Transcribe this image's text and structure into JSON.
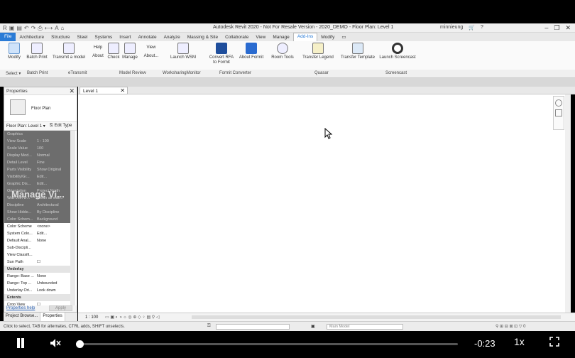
{
  "titlebar": {
    "title": "Autodesk Revit 2020 - Not For Resale Version - 2020_DEMO - Floor Plan: Level 1",
    "user": "minnieung",
    "qat_icons": [
      "revit-logo-icon",
      "open-icon",
      "save-icon",
      "undo-icon",
      "redo-icon",
      "print-icon",
      "measure-icon",
      "text-icon",
      "3d-view-icon"
    ]
  },
  "menu": {
    "file": "File",
    "tabs": [
      "Architecture",
      "Structure",
      "Steel",
      "Systems",
      "Insert",
      "Annotate",
      "Analyze",
      "Massing & Site",
      "Collaborate",
      "View",
      "Manage",
      "Add-Ins",
      "Modify"
    ],
    "active_tab": "Add-Ins"
  },
  "ribbon": {
    "buttons": [
      {
        "label": "Modify",
        "icon": "cursor-icon"
      },
      {
        "label": "Batch Print",
        "icon": "printer-icon"
      },
      {
        "label": "Transmit a model",
        "icon": "transmit-icon"
      },
      {
        "label": "About",
        "icon": "help-icon"
      },
      {
        "label": "Check",
        "icon": "check-icon"
      },
      {
        "label": "Manage",
        "icon": "manage-icon"
      },
      {
        "label": "About...",
        "icon": "view-icon"
      },
      {
        "label": "Launch WSM",
        "icon": "wsm-icon"
      },
      {
        "label": "Convert RFA to Formit",
        "icon": "formit-icon"
      },
      {
        "label": "About Formit",
        "icon": "formit-about-icon"
      },
      {
        "label": "Room Tools",
        "icon": "room-tools-icon"
      },
      {
        "label": "Transfer Legend",
        "icon": "legend-icon"
      },
      {
        "label": "Transfer Template",
        "icon": "template-icon"
      },
      {
        "label": "Launch Screencast",
        "icon": "screencast-icon"
      }
    ],
    "help_label": "Help",
    "view_label": "View",
    "panels": [
      "Select ▾",
      "Batch Print",
      "eTransmit",
      "Model Review",
      "WorksharingMonitor",
      "Formit Converter",
      "Quasar",
      "Screencast"
    ]
  },
  "properties": {
    "title": "Properties",
    "type_name": "Floor Plan",
    "selector": "Floor Plan: Level 1",
    "edit_type": "Edit Type",
    "watermark": "Manage Vi...",
    "rows": [
      {
        "k": "Graphics",
        "v": "",
        "style": "secgrey"
      },
      {
        "k": "View Scale",
        "v": "1 : 100",
        "style": "grey"
      },
      {
        "k": "Scale Value",
        "v": "100",
        "style": "grey"
      },
      {
        "k": "Display Mod...",
        "v": "Normal",
        "style": "grey"
      },
      {
        "k": "Detail Level",
        "v": "Fine",
        "style": "grey"
      },
      {
        "k": "Parts Visibility",
        "v": "Show Original",
        "style": "grey"
      },
      {
        "k": "Visibility/Gr...",
        "v": "Edit...",
        "style": "grey"
      },
      {
        "k": "Graphic Dis...",
        "v": "Edit...",
        "style": "grey"
      },
      {
        "k": "Orientation",
        "v": "Project North",
        "style": "grey"
      },
      {
        "k": "Wall Join D...",
        "v": "Clean all wall...",
        "style": "grey"
      },
      {
        "k": "Discipline",
        "v": "Architectural",
        "style": "grey"
      },
      {
        "k": "Show Hidde...",
        "v": "By Discipline",
        "style": "grey"
      },
      {
        "k": "Color Schem...",
        "v": "Background",
        "style": "grey"
      },
      {
        "k": "Color Scheme",
        "v": "<none>",
        "style": "white"
      },
      {
        "k": "System Colo...",
        "v": "Edit...",
        "style": "white"
      },
      {
        "k": "Default Anal...",
        "v": "None",
        "style": "white"
      },
      {
        "k": "Sub-Discipli...",
        "v": "",
        "style": "white"
      },
      {
        "k": "View Classifi...",
        "v": "",
        "style": "white"
      },
      {
        "k": "Sun Path",
        "v": "☐",
        "style": "white"
      },
      {
        "k": "Underlay",
        "v": "",
        "style": "sec"
      },
      {
        "k": "Range: Base ...",
        "v": "None",
        "style": "white"
      },
      {
        "k": "Range: Top ...",
        "v": "Unbounded",
        "style": "white"
      },
      {
        "k": "Underlay Ori...",
        "v": "Look down",
        "style": "white"
      },
      {
        "k": "Extents",
        "v": "",
        "style": "sec"
      },
      {
        "k": "Crop View",
        "v": "☐",
        "style": "white"
      }
    ],
    "help_link": "Properties help",
    "apply": "Apply"
  },
  "bottom_tabs": [
    "Project Browse...",
    "Properties"
  ],
  "view": {
    "tab": "Level 1",
    "scale": "1 : 100"
  },
  "status": {
    "message": "Click to select, TAB for alternates, CTRL adds, SHIFT unselects.",
    "model": "Main Model"
  },
  "player": {
    "time": "-0:23",
    "speed": "1x",
    "progress": 0.0
  }
}
